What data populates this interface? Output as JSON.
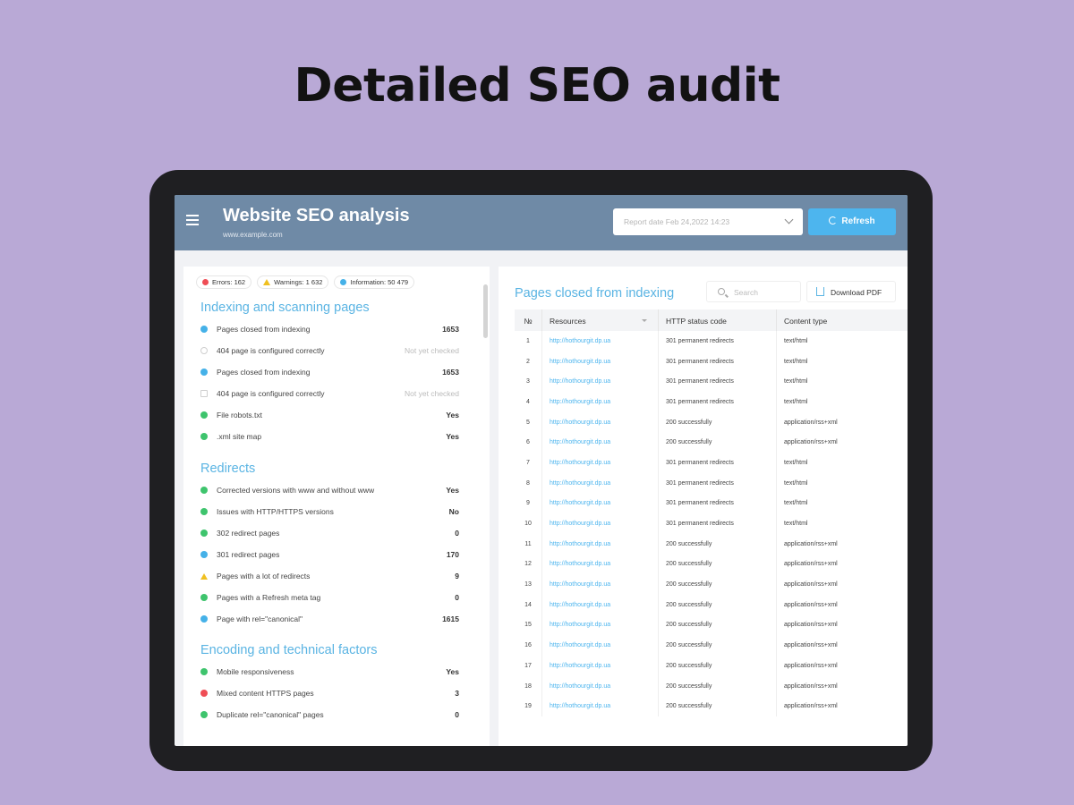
{
  "headline": "Detailed SEO audit",
  "header": {
    "title": "Website SEO analysis",
    "subtitle": "www.example.com",
    "report_date": "Report date Feb 24,2022 14:23",
    "refresh_label": "Refresh"
  },
  "chips": [
    {
      "label": "Errors: 162",
      "color": "#ef4d55"
    },
    {
      "label": "Warnings: 1 632",
      "color": "#f0c020"
    },
    {
      "label": "Information: 50 479",
      "color": "#45b1e8"
    }
  ],
  "sections": [
    {
      "title": "Indexing and scanning pages",
      "items": [
        {
          "label": "Pages closed from indexing",
          "value": "1653",
          "status": "info"
        },
        {
          "label": "404 page is configured correctly",
          "value": "Not yet checked",
          "status": "pending"
        },
        {
          "label": "Pages closed from indexing",
          "value": "1653",
          "status": "info"
        },
        {
          "label": "404 page is configured correctly",
          "value": "Not yet checked",
          "status": "pending-square"
        },
        {
          "label": "File robots.txt",
          "value": "Yes",
          "status": "ok"
        },
        {
          "label": ".xml site map",
          "value": "Yes",
          "status": "ok"
        }
      ]
    },
    {
      "title": "Redirects",
      "items": [
        {
          "label": "Corrected versions with www and without www",
          "value": "Yes",
          "status": "ok"
        },
        {
          "label": "Issues with HTTP/HTTPS versions",
          "value": "No",
          "status": "ok"
        },
        {
          "label": "302 redirect pages",
          "value": "0",
          "status": "ok"
        },
        {
          "label": "301 redirect pages",
          "value": "170",
          "status": "info"
        },
        {
          "label": "Pages with a lot of redirects",
          "value": "9",
          "status": "warning"
        },
        {
          "label": "Pages with a Refresh meta tag",
          "value": "0",
          "status": "ok"
        },
        {
          "label": "Page with rel=\"canonical\"",
          "value": "1615",
          "status": "info"
        }
      ]
    },
    {
      "title": "Encoding and technical factors",
      "items": [
        {
          "label": "Mobile responsiveness",
          "value": "Yes",
          "status": "ok"
        },
        {
          "label": "Mixed content HTTPS pages",
          "value": "3",
          "status": "error"
        },
        {
          "label": "Duplicate rel=\"canonical\" pages",
          "value": "0",
          "status": "ok"
        }
      ]
    }
  ],
  "table": {
    "title": "Pages closed from indexing",
    "search_placeholder": "Search",
    "download_label": "Download PDF",
    "columns": [
      "№",
      "Resources",
      "HTTP status code",
      "Content type"
    ],
    "rows": [
      [
        "1",
        "http://hothourgit.dp.ua",
        "301 permanent redirects",
        "text/html"
      ],
      [
        "2",
        "http://hothourgit.dp.ua",
        "301 permanent redirects",
        "text/html"
      ],
      [
        "3",
        "http://hothourgit.dp.ua",
        "301 permanent redirects",
        "text/html"
      ],
      [
        "4",
        "http://hothourgit.dp.ua",
        "301 permanent redirects",
        "text/html"
      ],
      [
        "5",
        "http://hothourgit.dp.ua",
        "200 successfully",
        "application/rss+xml"
      ],
      [
        "6",
        "http://hothourgit.dp.ua",
        "200 successfully",
        "application/rss+xml"
      ],
      [
        "7",
        "http://hothourgit.dp.ua",
        "301 permanent redirects",
        "text/html"
      ],
      [
        "8",
        "http://hothourgit.dp.ua",
        "301 permanent redirects",
        "text/html"
      ],
      [
        "9",
        "http://hothourgit.dp.ua",
        "301 permanent redirects",
        "text/html"
      ],
      [
        "10",
        "http://hothourgit.dp.ua",
        "301 permanent redirects",
        "text/html"
      ],
      [
        "11",
        "http://hothourgit.dp.ua",
        "200 successfully",
        "application/rss+xml"
      ],
      [
        "12",
        "http://hothourgit.dp.ua",
        "200 successfully",
        "application/rss+xml"
      ],
      [
        "13",
        "http://hothourgit.dp.ua",
        "200 successfully",
        "application/rss+xml"
      ],
      [
        "14",
        "http://hothourgit.dp.ua",
        "200 successfully",
        "application/rss+xml"
      ],
      [
        "15",
        "http://hothourgit.dp.ua",
        "200 successfully",
        "application/rss+xml"
      ],
      [
        "16",
        "http://hothourgit.dp.ua",
        "200 successfully",
        "application/rss+xml"
      ],
      [
        "17",
        "http://hothourgit.dp.ua",
        "200 successfully",
        "application/rss+xml"
      ],
      [
        "18",
        "http://hothourgit.dp.ua",
        "200 successfully",
        "application/rss+xml"
      ],
      [
        "19",
        "http://hothourgit.dp.ua",
        "200 successfully",
        "application/rss+xml"
      ]
    ]
  },
  "colors": {
    "background": "#b9a9d6",
    "topbar": "#6f8aa6",
    "accent": "#4db5ee",
    "ok": "#3ec46d",
    "error": "#ef4d55",
    "warning": "#f0c020",
    "info": "#45b1e8"
  }
}
